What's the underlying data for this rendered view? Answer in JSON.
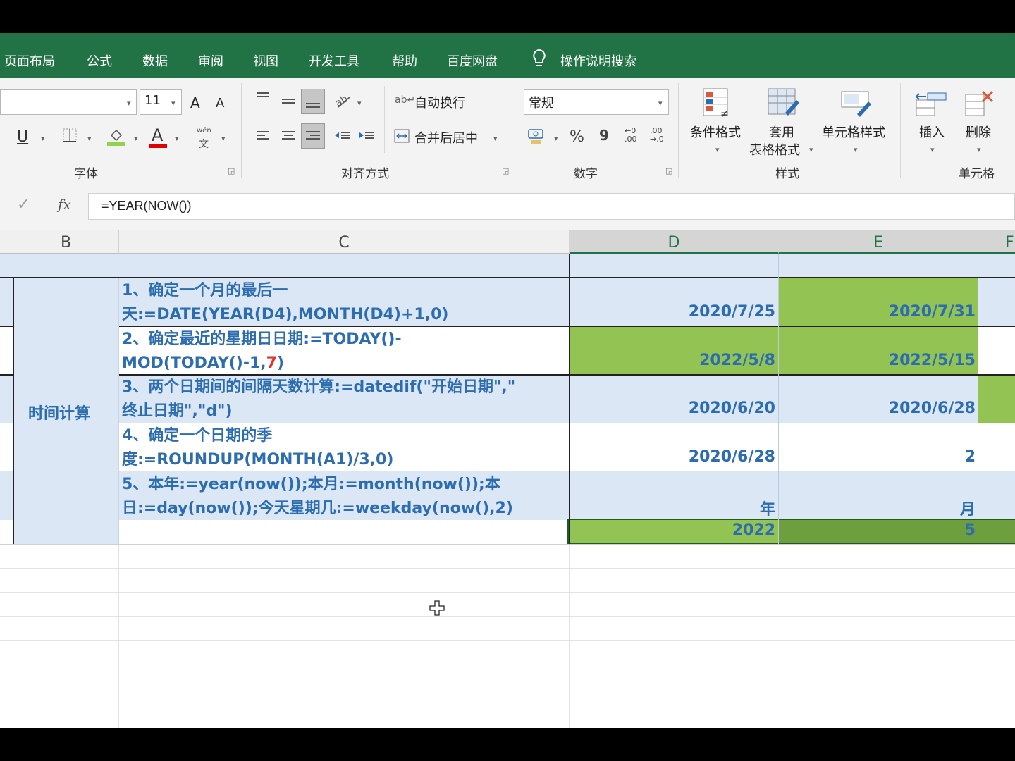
{
  "menu_tabs": [
    "页面布局",
    "公式",
    "数据",
    "审阅",
    "视图",
    "开发工具",
    "帮助",
    "百度网盘"
  ],
  "tell_me": "操作说明搜索",
  "ribbon": {
    "font_size": "11",
    "font_grow": "A",
    "font_shrink": "A",
    "underline": "U",
    "font_color_letter": "A",
    "phonetic": "wén",
    "wrap_text": "自动换行",
    "merge_center": "合并后居中",
    "number_format": "常规",
    "percent": "%",
    "comma": "9",
    "cond_format": "条件格式",
    "table_format_1": "套用",
    "table_format_2": "表格格式",
    "cell_styles": "单元格样式",
    "insert": "插入",
    "delete": "删除",
    "groups": {
      "font": "字体",
      "alignment": "对齐方式",
      "number": "数字",
      "styles": "样式",
      "cells": "单元格"
    }
  },
  "formula_bar": {
    "check": "✓",
    "fx": "fx",
    "formula": "=YEAR(NOW())"
  },
  "columns": [
    "B",
    "C",
    "D",
    "E",
    "F"
  ],
  "category_label": "时间计算",
  "rows": [
    {
      "c_line1": "1、确定一个月的最后一",
      "c_line2": "天:=DATE(YEAR(D4),MONTH(D4)+1,0)",
      "d": "2020/7/25",
      "e": "2020/7/31"
    },
    {
      "c_line1": "2、确定最近的星期日日期:=TODAY()-",
      "c_line2_a": "MOD(TODAY()-1,",
      "c_line2_red": "7",
      "c_line2_b": ")",
      "d": "2022/5/8",
      "e": "2022/5/15"
    },
    {
      "c_line1": "3、两个日期间的间隔天数计算:=datedif(\"开始日期\",\"",
      "c_line2": "终止日期\",\"d\")",
      "d": "2020/6/20",
      "e": "2020/6/28"
    },
    {
      "c_line1": "4、确定一个日期的季",
      "c_line2": "度:=ROUNDUP(MONTH(A1)/3,0)",
      "d": "2020/6/28",
      "e": "2"
    },
    {
      "c_line1": "5、本年:=year(now());本月:=month(now());本",
      "c_line2": "日:=day(now());今天星期几:=weekday(now(),2)",
      "d": "年",
      "e": "月"
    },
    {
      "d": "2022",
      "e": "5"
    }
  ],
  "colors": {
    "ribbon_green": "#217346",
    "cell_blue": "#dbe7f4",
    "cell_green": "#92c353",
    "cell_dark_green": "#6f9e3f",
    "text_blue": "#2c6cb0",
    "red": "#e03030"
  }
}
